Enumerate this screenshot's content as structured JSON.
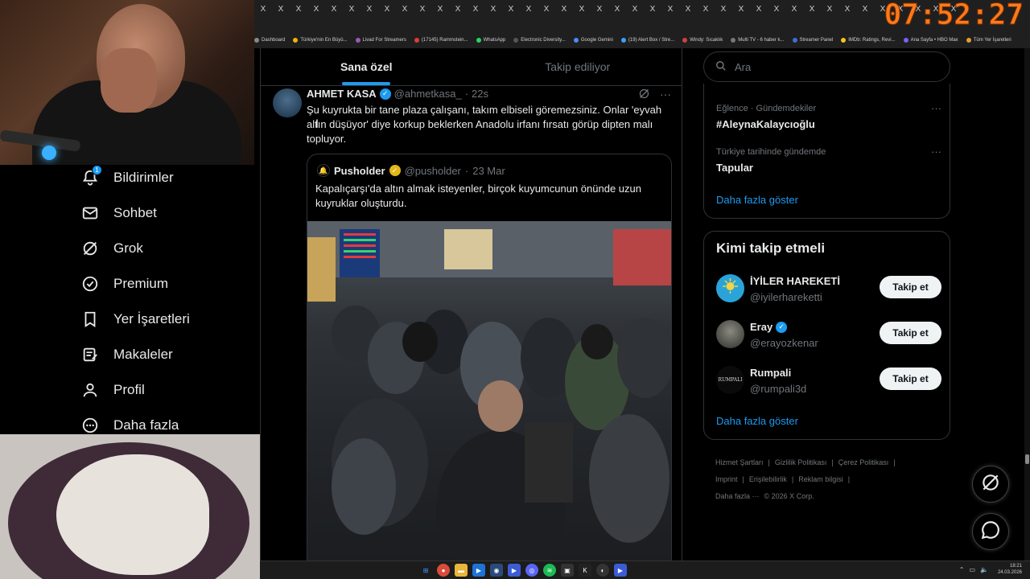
{
  "browser": {
    "tabs": [
      "X",
      "X",
      "X",
      "X",
      "X",
      "X",
      "X",
      "X",
      "X",
      "X",
      "X",
      "X",
      "X",
      "X",
      "X",
      "X",
      "X",
      "X",
      "X",
      "X",
      "X",
      "X",
      "X",
      "X",
      "X",
      "X",
      "X",
      "X",
      "X",
      "X",
      "X",
      "X",
      "X",
      "X",
      "X",
      "X",
      "X",
      "X",
      "X",
      "X"
    ],
    "bookmarks": [
      "Dashboard",
      "Türkiye'nin En Büyü...",
      "Livad For Streamers",
      "(17145) Rammstein...",
      "WhatsApp",
      "Electronic Diversity...",
      "Google Gemini",
      "(19) Alert Box / Stre...",
      "Windy: Sıcaklık",
      "Multi TV - 6 haber k...",
      "Streamer Panel",
      "IMDb: Ratings, Revi...",
      "Ana Sayfa • HBO Max",
      "Tüm Yer İşaretleri"
    ]
  },
  "overlay": {
    "clock": "07:52:27"
  },
  "nav": {
    "items": [
      {
        "label": "Bildirimler",
        "icon": "bell-icon",
        "badge": "1"
      },
      {
        "label": "Sohbet",
        "icon": "mail-icon"
      },
      {
        "label": "Grok",
        "icon": "grok-icon"
      },
      {
        "label": "Premium",
        "icon": "premium-icon"
      },
      {
        "label": "Yer İşaretleri",
        "icon": "bookmark-icon"
      },
      {
        "label": "Makaleler",
        "icon": "article-icon"
      },
      {
        "label": "Profil",
        "icon": "person-icon"
      },
      {
        "label": "Daha fazla",
        "icon": "more-circle-icon"
      }
    ]
  },
  "feed": {
    "tabs": [
      {
        "label": "Sana özel",
        "active": true
      },
      {
        "label": "Takip ediliyor",
        "active": false
      }
    ],
    "tweet": {
      "name": "AHMET KASA",
      "handle": "@ahmetkasa_",
      "time": "22s",
      "text": "Şu kuyrukta bir tane plaza çalışanı, takım elbiseli göremezsiniz. Onlar 'eyvah altın düşüyor' diye korkup beklerken Anadolu irfanı fırsatı görüp dipten malı topluyor.",
      "quote": {
        "name": "Pusholder",
        "handle": "@pusholder",
        "date": "23 Mar",
        "text": "Kapalıçarşı'da altın almak isteyenler, birçok kuyumcunun önünde uzun kuyruklar oluşturdu."
      }
    }
  },
  "sidebar": {
    "search_placeholder": "Ara",
    "trends": [
      {
        "meta": "Eğlence · Gündemdekiler",
        "name": "#AleynaKalaycıoğlu"
      },
      {
        "meta": "Türkiye tarihinde gündemde",
        "name": "Tapular"
      }
    ],
    "trends_more": "Daha fazla göster",
    "who_to_follow": {
      "title": "Kimi takip etmeli",
      "accounts": [
        {
          "name": "İYİLER HAREKETİ",
          "handle": "@iyilerhareketti",
          "verified": false,
          "button": "Takip et"
        },
        {
          "name": "Eray",
          "handle": "@erayozkenar",
          "verified": true,
          "button": "Takip et"
        },
        {
          "name": "Rumpali",
          "handle": "@rumpali3d",
          "verified": false,
          "button": "Takip et"
        }
      ],
      "more": "Daha fazla göster"
    },
    "footer": [
      "Hizmet Şartları",
      "|",
      "Gizlilik Politikası",
      "|",
      "Çerez Politikası",
      "|",
      "Imprint",
      "|",
      "Erişilebilirlik",
      "|",
      "Reklam bilgisi",
      "|",
      "Daha fazla ···",
      "© 2026 X Corp."
    ]
  },
  "taskbar": {
    "time": "18:21",
    "date": "24.03.2026"
  },
  "colors": {
    "accent": "#1d9bf0",
    "gold": "#e2b719",
    "clock": "#ff7a1a"
  }
}
